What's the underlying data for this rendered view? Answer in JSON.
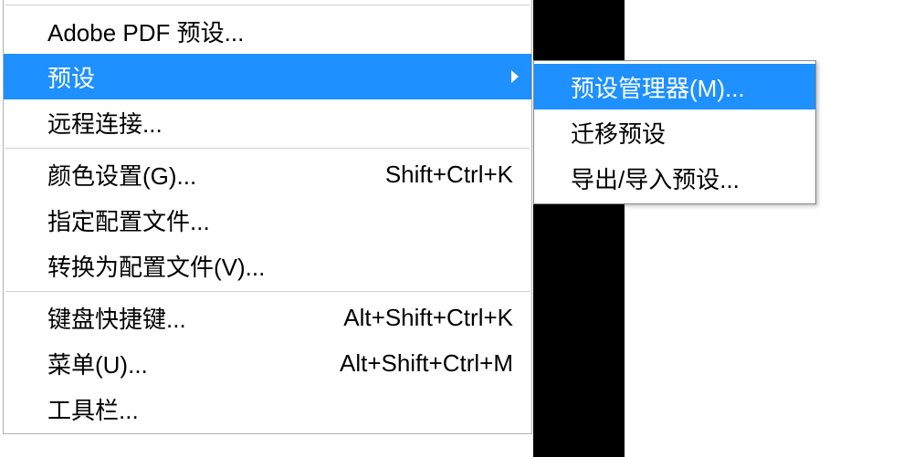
{
  "main_menu": {
    "adobe_pdf_presets": "Adobe PDF 预设...",
    "presets": "预设",
    "remote_connect": "远程连接...",
    "color_settings": "颜色设置(G)...",
    "color_settings_shortcut": "Shift+Ctrl+K",
    "assign_profile": "指定配置文件...",
    "convert_profile": "转换为配置文件(V)...",
    "keyboard_shortcuts": "键盘快捷键...",
    "keyboard_shortcuts_shortcut": "Alt+Shift+Ctrl+K",
    "menus": "菜单(U)...",
    "menus_shortcut": "Alt+Shift+Ctrl+M",
    "toolbar": "工具栏..."
  },
  "submenu": {
    "preset_manager": "预设管理器(M)...",
    "migrate_presets": "迁移预设",
    "export_import_presets": "导出/导入预设..."
  },
  "colors": {
    "highlight": "#1e90ff"
  }
}
